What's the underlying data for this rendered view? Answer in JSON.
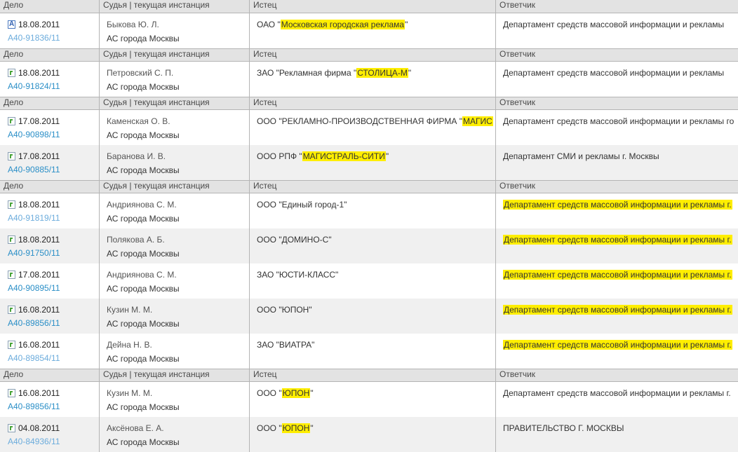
{
  "headers": {
    "case": "Дело",
    "judge": "Судья | текущая инстанция",
    "plaintiff": "Истец",
    "defendant": "Ответчик"
  },
  "groups": [
    {
      "rows": [
        {
          "icon": "a",
          "date": "18.08.2011",
          "case": "А40-91836/11",
          "visited": true,
          "judge": "Быкова Ю. Л.",
          "court": "АС города Москвы",
          "p_pre": "ОАО \"",
          "p_hl": "Московская городская реклама",
          "p_post": "\"",
          "d_pre": "Департамент средств массовой информации и рекламы",
          "d_hl": "",
          "d_post": ""
        }
      ]
    },
    {
      "rows": [
        {
          "icon": "g",
          "date": "18.08.2011",
          "case": "А40-91824/11",
          "visited": false,
          "judge": "Петровский С. П.",
          "court": "АС города Москвы",
          "p_pre": "ЗАО \"Рекламная фирма \"",
          "p_hl": "СТОЛИЦА-М",
          "p_post": "\"",
          "d_pre": "Департамент средств массовой информации и рекламы",
          "d_hl": "",
          "d_post": ""
        }
      ]
    },
    {
      "rows": [
        {
          "icon": "g",
          "date": "17.08.2011",
          "case": "А40-90898/11",
          "visited": false,
          "judge": "Каменская О. В.",
          "court": "АС города Москвы",
          "p_pre": "ООО \"РЕКЛАМНО-ПРОИЗВОДСТВЕННАЯ ФИРМА \"",
          "p_hl": "МАГИС",
          "p_post": "",
          "d_pre": "Департамент средств массовой информации и рекламы го",
          "d_hl": "",
          "d_post": ""
        },
        {
          "icon": "g",
          "date": "17.08.2011",
          "case": "А40-90885/11",
          "visited": false,
          "judge": "Баранова И. В.",
          "court": "АС города Москвы",
          "p_pre": "ООО РПФ \"",
          "p_hl": "МАГИСТРАЛЬ-СИТИ",
          "p_post": "\"",
          "d_pre": "Департамент СМИ и рекламы г. Москвы",
          "d_hl": "",
          "d_post": ""
        }
      ]
    },
    {
      "rows": [
        {
          "icon": "g",
          "date": "18.08.2011",
          "case": "А40-91819/11",
          "visited": true,
          "judge": "Андриянова С. М.",
          "court": "АС города Москвы",
          "p_pre": "ООО \"Единый город-1\"",
          "p_hl": "",
          "p_post": "",
          "d_pre": "",
          "d_hl": "Департамент средств массовой информации и рекламы г.",
          "d_post": ""
        },
        {
          "icon": "g",
          "date": "18.08.2011",
          "case": "А40-91750/11",
          "visited": false,
          "judge": "Полякова А. Б.",
          "court": "АС города Москвы",
          "p_pre": "ООО \"ДОМИНО-С\"",
          "p_hl": "",
          "p_post": "",
          "d_pre": "",
          "d_hl": "Департамент средств массовой информации и рекламы г.",
          "d_post": ""
        },
        {
          "icon": "g",
          "date": "17.08.2011",
          "case": "А40-90895/11",
          "visited": false,
          "judge": "Андриянова С. М.",
          "court": "АС города Москвы",
          "p_pre": "ЗАО \"ЮСТИ-КЛАСС\"",
          "p_hl": "",
          "p_post": "",
          "d_pre": "",
          "d_hl": "Департамент средств массовой информации и рекламы г.",
          "d_post": ""
        },
        {
          "icon": "g",
          "date": "16.08.2011",
          "case": "А40-89856/11",
          "visited": false,
          "judge": "Кузин М. М.",
          "court": "АС города Москвы",
          "p_pre": "ООО \"ЮПОН\"",
          "p_hl": "",
          "p_post": "",
          "d_pre": "",
          "d_hl": "Департамент средств массовой информации и рекламы г.",
          "d_post": ""
        },
        {
          "icon": "g",
          "date": "16.08.2011",
          "case": "А40-89854/11",
          "visited": true,
          "judge": "Дейна Н. В.",
          "court": "АС города Москвы",
          "p_pre": "ЗАО \"ВИАТРА\"",
          "p_hl": "",
          "p_post": "",
          "d_pre": "",
          "d_hl": "Департамент средств массовой информации и рекламы г.",
          "d_post": ""
        }
      ]
    },
    {
      "rows": [
        {
          "icon": "g",
          "date": "16.08.2011",
          "case": "А40-89856/11",
          "visited": false,
          "judge": "Кузин М. М.",
          "court": "АС города Москвы",
          "p_pre": "ООО \"",
          "p_hl": "ЮПОН",
          "p_post": "\"",
          "d_pre": "Департамент средств массовой информации и рекламы г.",
          "d_hl": "",
          "d_post": ""
        },
        {
          "icon": "g",
          "date": "04.08.2011",
          "case": "А40-84936/11",
          "visited": true,
          "judge": "Аксёнова Е. А.",
          "court": "АС города Москвы",
          "p_pre": "ООО \"",
          "p_hl": "ЮПОН",
          "p_post": "\"",
          "d_pre": "ПРАВИТЕЛЬСТВО Г. МОСКВЫ",
          "d_hl": "",
          "d_post": ""
        }
      ]
    }
  ]
}
